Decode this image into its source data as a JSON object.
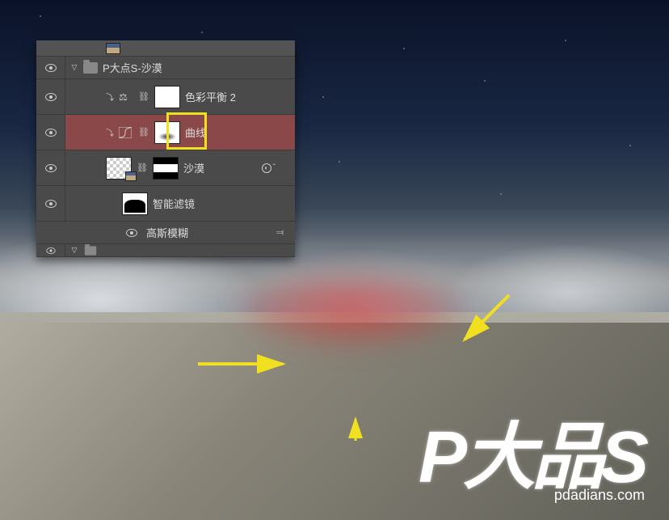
{
  "layers_panel": {
    "group_name": "P大点S-沙漠",
    "layers": [
      {
        "name": "色彩平衡 2",
        "type": "adjustment"
      },
      {
        "name": "曲线",
        "type": "adjustment",
        "selected": true
      },
      {
        "name": "沙漠",
        "type": "smart-object",
        "has_fx": true
      },
      {
        "name": "智能滤镜",
        "type": "filter-group"
      },
      {
        "name": "高斯模糊",
        "type": "filter"
      }
    ]
  },
  "watermark": {
    "logo_text": "P大品S",
    "url": "pdadians.com"
  },
  "annotations": {
    "arrows": [
      {
        "from": "left",
        "color": "#f0e020"
      },
      {
        "from": "top-right",
        "color": "#f0e020"
      },
      {
        "from": "bottom",
        "color": "#f0e020"
      }
    ]
  }
}
